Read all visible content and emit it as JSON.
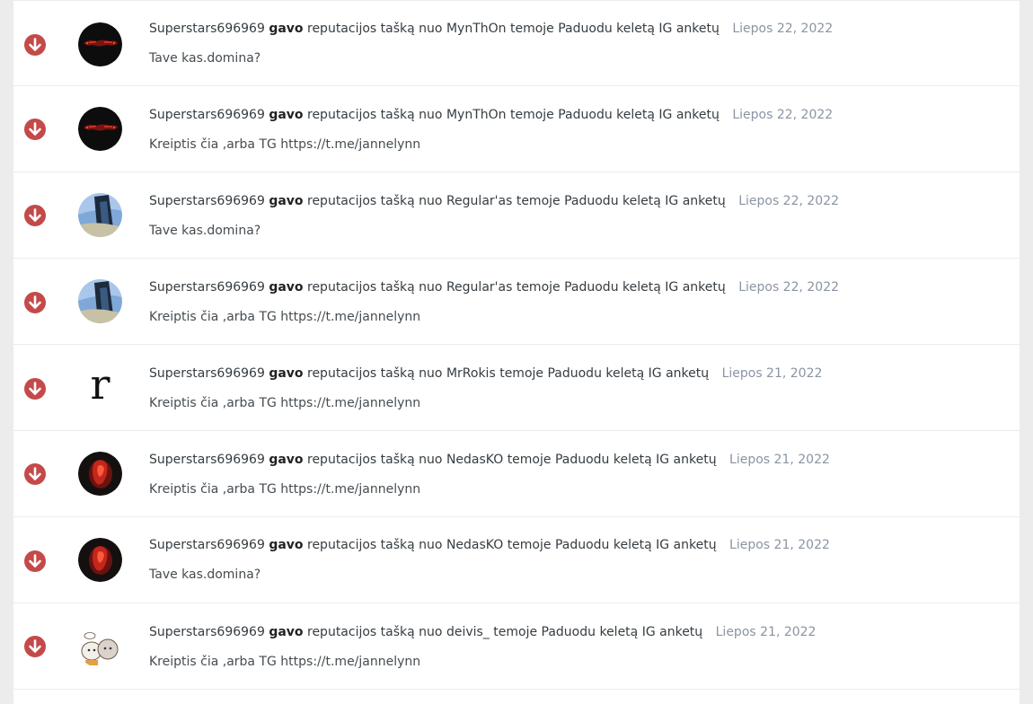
{
  "colors": {
    "negative_rep": "#c44a4a",
    "date": "#8a94a3",
    "page_bg": "#ececec",
    "panel_bg": "#ffffff"
  },
  "feed": [
    {
      "icon": "arrow-down-icon",
      "avatar": "red-dark-avatar",
      "user": "Superstars696969",
      "verb": "gavo",
      "middle": "reputacijos tašką nuo",
      "giver": "MynThOn",
      "topic_prefix": "temoje",
      "topic": "Paduodu keletą IG anketų",
      "date": "Liepos 22, 2022",
      "snippet": "Tave kas.domina?"
    },
    {
      "icon": "arrow-down-icon",
      "avatar": "red-dark-avatar",
      "user": "Superstars696969",
      "verb": "gavo",
      "middle": "reputacijos tašką nuo",
      "giver": "MynThOn",
      "topic_prefix": "temoje",
      "topic": "Paduodu keletą IG anketų",
      "date": "Liepos 22, 2022",
      "snippet": "Kreiptis čia ,arba TG https://t.me/jannelynn"
    },
    {
      "icon": "arrow-down-icon",
      "avatar": "blue-photo-avatar",
      "user": "Superstars696969",
      "verb": "gavo",
      "middle": "reputacijos tašką nuo",
      "giver": "Regular'as",
      "topic_prefix": "temoje",
      "topic": "Paduodu keletą IG anketų",
      "date": "Liepos 22, 2022",
      "snippet": "Tave kas.domina?"
    },
    {
      "icon": "arrow-down-icon",
      "avatar": "blue-photo-avatar",
      "user": "Superstars696969",
      "verb": "gavo",
      "middle": "reputacijos tašką nuo",
      "giver": "Regular'as",
      "topic_prefix": "temoje",
      "topic": "Paduodu keletą IG anketų",
      "date": "Liepos 22, 2022",
      "snippet": "Kreiptis čia ,arba TG https://t.me/jannelynn"
    },
    {
      "icon": "arrow-down-icon",
      "avatar": "letter-r-avatar",
      "avatar_letter": "r",
      "user": "Superstars696969",
      "verb": "gavo",
      "middle": "reputacijos tašką nuo",
      "giver": "MrRokis",
      "topic_prefix": "temoje",
      "topic": "Paduodu keletą IG anketų",
      "date": "Liepos 21, 2022",
      "snippet": "Kreiptis čia ,arba TG https://t.me/jannelynn"
    },
    {
      "icon": "arrow-down-icon",
      "avatar": "red-figure-avatar",
      "user": "Superstars696969",
      "verb": "gavo",
      "middle": "reputacijos tašką nuo",
      "giver": "NedasKO",
      "topic_prefix": "temoje",
      "topic": "Paduodu keletą IG anketų",
      "date": "Liepos 21, 2022",
      "snippet": "Kreiptis čia ,arba TG https://t.me/jannelynn"
    },
    {
      "icon": "arrow-down-icon",
      "avatar": "red-figure-avatar",
      "user": "Superstars696969",
      "verb": "gavo",
      "middle": "reputacijos tašką nuo",
      "giver": "NedasKO",
      "topic_prefix": "temoje",
      "topic": "Paduodu keletą IG anketų",
      "date": "Liepos 21, 2022",
      "snippet": "Tave kas.domina?"
    },
    {
      "icon": "arrow-down-icon",
      "avatar": "cartoon-cats-avatar",
      "user": "Superstars696969",
      "verb": "gavo",
      "middle": "reputacijos tašką nuo",
      "giver": "deivis_",
      "topic_prefix": "temoje",
      "topic": "Paduodu keletą IG anketų",
      "date": "Liepos 21, 2022",
      "snippet": "Kreiptis čia ,arba TG https://t.me/jannelynn"
    }
  ]
}
